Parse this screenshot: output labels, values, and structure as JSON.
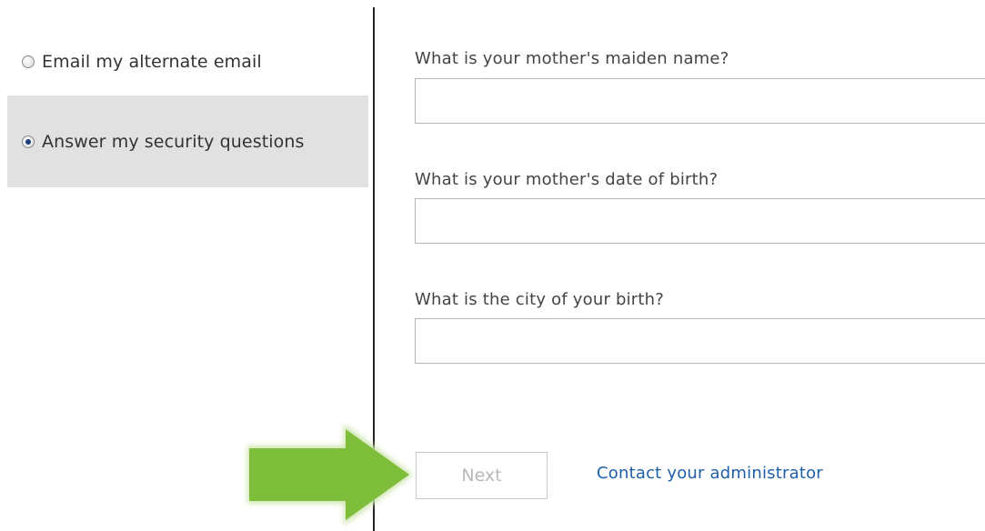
{
  "options": [
    {
      "label": "Email my alternate email",
      "selected": false
    },
    {
      "label": "Answer my security questions",
      "selected": true
    }
  ],
  "questions": [
    {
      "label": "What is your mother's maiden name?",
      "value": ""
    },
    {
      "label": "What is your mother's date of birth?",
      "value": ""
    },
    {
      "label": "What is the city of your birth?",
      "value": ""
    }
  ],
  "actions": {
    "next_label": "Next",
    "contact_label": "Contact your administrator"
  },
  "colors": {
    "selected_option_bg": "#e1e1e1",
    "link": "#1f5fa8",
    "arrow": "#7fbe3a",
    "disabled_text": "#b8b8b8"
  },
  "annotation": {
    "icon": "right-arrow-icon"
  }
}
